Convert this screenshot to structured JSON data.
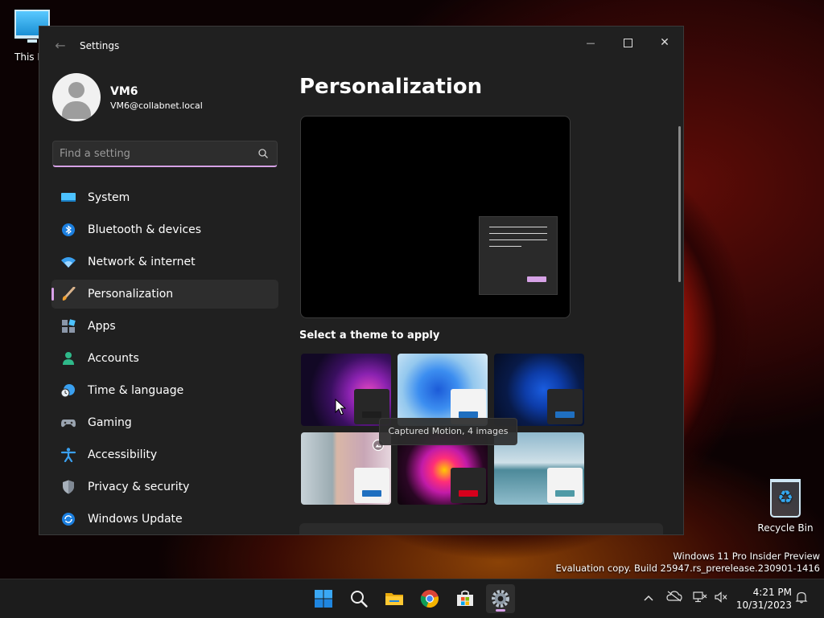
{
  "desktop": {
    "this_pc_label": "This PC",
    "recycle_bin_label": "Recycle Bin"
  },
  "window": {
    "title": "Settings",
    "minimize_symbol": "—",
    "close_symbol": "✕"
  },
  "user": {
    "name": "VM6",
    "email": "VM6@collabnet.local"
  },
  "search": {
    "placeholder": "Find a setting"
  },
  "nav": {
    "items": [
      {
        "label": "System",
        "icon": "monitor-icon"
      },
      {
        "label": "Bluetooth & devices",
        "icon": "bluetooth-icon"
      },
      {
        "label": "Network & internet",
        "icon": "wifi-icon"
      },
      {
        "label": "Personalization",
        "icon": "brush-icon",
        "active": true
      },
      {
        "label": "Apps",
        "icon": "apps-icon"
      },
      {
        "label": "Accounts",
        "icon": "person-icon"
      },
      {
        "label": "Time & language",
        "icon": "globe-clock-icon"
      },
      {
        "label": "Gaming",
        "icon": "gamepad-icon"
      },
      {
        "label": "Accessibility",
        "icon": "accessibility-icon"
      },
      {
        "label": "Privacy & security",
        "icon": "shield-icon"
      },
      {
        "label": "Windows Update",
        "icon": "update-icon"
      }
    ]
  },
  "main": {
    "title": "Personalization",
    "theme_section_label": "Select a theme to apply",
    "tooltip": "Captured Motion, 4 images",
    "theme_accents": [
      "#1e1e1e",
      "#1f6fc0",
      "#1f6fc0",
      "#1f6fc0",
      "#d6001c",
      "#4f9aa6"
    ]
  },
  "watermark": {
    "line1": "Windows 11 Pro Insider Preview",
    "line2": "Evaluation copy. Build 25947.rs_prerelease.230901-1416"
  },
  "clock": {
    "time": "4:21 PM",
    "date": "10/31/2023"
  },
  "colors": {
    "accent": "#d8a0e8",
    "window_bg": "#202020"
  }
}
